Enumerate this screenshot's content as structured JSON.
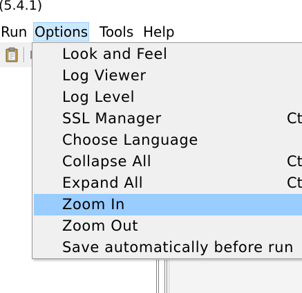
{
  "window": {
    "title_fragment": "(5.4.1)"
  },
  "menubar": {
    "items": [
      {
        "label": "Run"
      },
      {
        "label": "Options"
      },
      {
        "label": "Tools"
      },
      {
        "label": "Help"
      }
    ],
    "active": "Options"
  },
  "toolbar": {
    "icons": [
      "clipboard-icon"
    ]
  },
  "options_menu": {
    "items": [
      {
        "label": "Look and Feel",
        "shortcut": ""
      },
      {
        "label": "Log Viewer",
        "shortcut": ""
      },
      {
        "label": "Log Level",
        "shortcut": ""
      },
      {
        "label": "SSL Manager",
        "shortcut": "Ct"
      },
      {
        "label": "Choose Language",
        "shortcut": ""
      },
      {
        "label": "Collapse All",
        "shortcut": "Ct"
      },
      {
        "label": "Expand All",
        "shortcut": "Ct"
      },
      {
        "label": "Zoom In",
        "shortcut": ""
      },
      {
        "label": "Zoom Out",
        "shortcut": ""
      },
      {
        "label": "Save automatically before run",
        "shortcut": ""
      }
    ],
    "highlighted": "Zoom In"
  },
  "colors": {
    "menu_highlight": "#99ccff",
    "menubar_active_bg": "#cce8ff",
    "menubar_active_border": "#99d1ff",
    "menu_bg": "#f0f0f0"
  }
}
